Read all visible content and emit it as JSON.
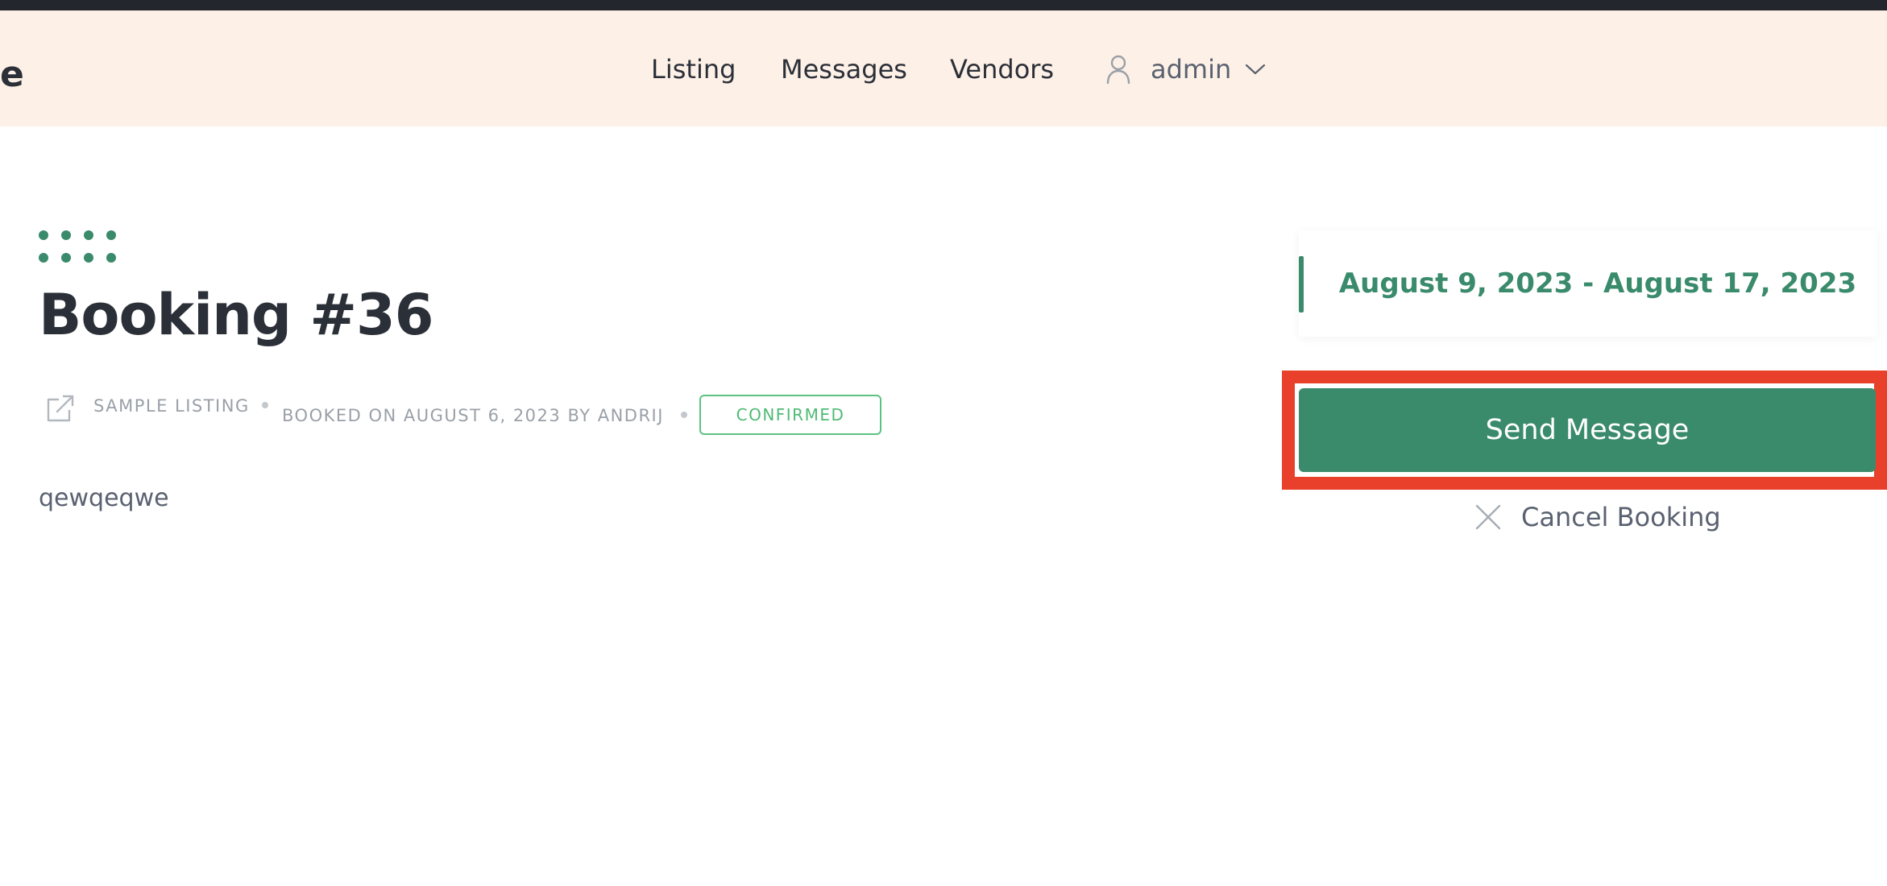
{
  "header": {
    "logo_fragment": "e",
    "nav": [
      {
        "label": "Listing"
      },
      {
        "label": "Messages"
      },
      {
        "label": "Vendors"
      }
    ],
    "user": {
      "name": "admin",
      "icon": "user-icon",
      "dropdown_icon": "chevron-down-icon"
    }
  },
  "booking": {
    "title": "Booking #36",
    "listing_link": "SAMPLE LISTING",
    "listing_icon": "external-link-icon",
    "booked_info": "BOOKED ON AUGUST 6, 2023 BY ANDRIJ",
    "status": "CONFIRMED",
    "description": "qewqeqwe"
  },
  "sidebar": {
    "date_range": "August 9, 2023 - August 17, 2023",
    "send_message_label": "Send Message",
    "cancel_label": "Cancel Booking",
    "cancel_icon": "close-icon"
  },
  "colors": {
    "brand": "#3a8a6c",
    "header_bg": "#fdf0e6",
    "top_bar": "#23262d",
    "status_confirmed": "#4fbb74",
    "highlight": "#e8402a",
    "text_dark": "#2b2f38",
    "text_muted": "#9aa0a8"
  }
}
